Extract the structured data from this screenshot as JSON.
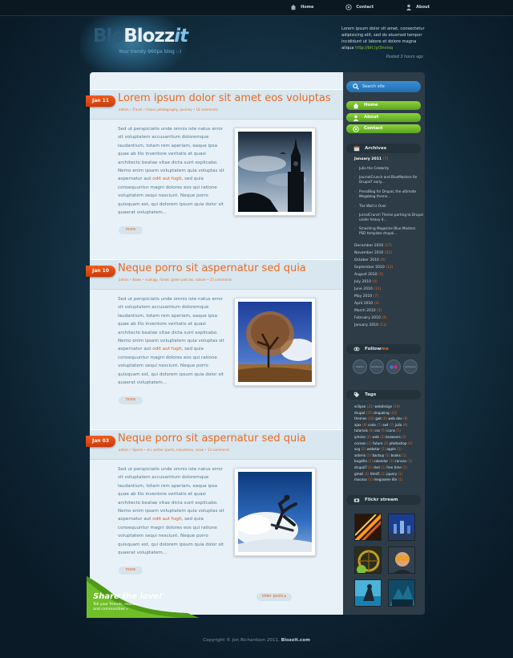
{
  "topnav": {
    "items": [
      {
        "label": "Home",
        "icon": "house-icon"
      },
      {
        "label": "Contact",
        "icon": "at-icon"
      },
      {
        "label": "About",
        "icon": "user-icon"
      }
    ]
  },
  "header": {
    "logo_ghost": "Blo",
    "logo_main": "Blozz",
    "logo_it": "it",
    "tagline": "Your trendy 960px blog :-)"
  },
  "tweet": {
    "text": "Lorem ipsum dolor sit amet, consectetur adipisicing elit, sed do eiusmod tempor incididunt ut labore et dolore magna aliqua",
    "link": "http://bit.ly/3nvisq",
    "time": "Posted 3 hours ago"
  },
  "posts": [
    {
      "date": "Jan 11",
      "title": "Lorem ipsum dolor sit amet eos voluptas",
      "meta": [
        "admin",
        "Travel",
        "travel, photography, journey",
        "18 comments"
      ],
      "text_a": "Sed ut perspiciatis unde omnis iste natus error sit voluptatem accusantium doloremque laudantium, totam rem aperiam, eaque ipsa quae ab illo inventore veritatis et quasi architecto beatae vitae dicta sunt explicabo. Nemo enim ipsam voluptatem quia voluptas sit aspernatur aut ",
      "highlight": "odit aut fugit",
      "text_b": ", sed quia consequuntur magni dolores eos qui ratione voluptatem sequi nesciunt. Neque porro quisquam est, qui dolorem ipsum quia dolor sit quaerat voluptatem...",
      "more": "more"
    },
    {
      "date": "Jan 10",
      "title": "Neque porro sit aspernatur sed quia",
      "meta": [
        "admin",
        "News",
        "ecology, forest, green policies, nature",
        "25 comments"
      ],
      "text_a": "Sed ut perspiciatis unde omnis iste natus error sit voluptatem accusantium doloremque laudantium, totam rem aperiam, eaque ipsa quae ab illo inventore veritatis et quasi architecto beatae vitae dicta sunt explicabo. Nemo enim ipsam voluptatem quia voluptas sit aspernatur aut ",
      "highlight": "odit aut fugit",
      "text_b": ", sed quia consequuntur magni dolores eos qui ratione voluptatem sequi nesciunt. Neque porro quisquam est, qui dolorem ipsum quia dolor sit quaerat voluptatem...",
      "more": "more"
    },
    {
      "date": "Jan 03",
      "title": "Neque porro sit aspernatur sed quia",
      "meta": [
        "admin",
        "Sports",
        "ski, winter sports, mountains, snow",
        "13 comments"
      ],
      "text_a": "Sed ut perspiciatis unde omnis iste natus error sit voluptatem accusantium doloremque laudantium, totam rem aperiam, eaque ipsa quae ab illo inventore veritatis et quasi architecto beatae vitae dicta sunt explicabo. Nemo enim ipsam voluptatem quia voluptas sit aspernatur aut ",
      "highlight": "odit aut fugit",
      "text_b": ", sed quia consequuntur magni dolores eos qui ratione voluptatem sequi nesciunt. Neque porro quisquam est, qui dolorem ipsum quia dolor sit quaerat voluptatem...",
      "more": "more"
    }
  ],
  "older": "older posts ▸",
  "share": {
    "title": "Share the love!",
    "sub": "Tell your friends, readers and communities »"
  },
  "sidebar": {
    "search_placeholder": "Search site",
    "nav": [
      "Home",
      "About",
      "Contact"
    ],
    "archives_title": "Archives",
    "current_year": "January 2011",
    "current_count": "(7)",
    "recent_posts": [
      "Julia the Celebrity",
      "JournalCrunch and BlueMasters for Drupal7 early...",
      "PressBlog for Drupal, the ultimate Megablog theme...",
      "The Wall is Over",
      "JurnalCrunch Theme porting to Drupal under heavy d...",
      "Smashing Magazine Blue Masters PSD template drupal..."
    ],
    "months": [
      {
        "label": "December 2010",
        "count": "(17)"
      },
      {
        "label": "November 2010",
        "count": "(22)"
      },
      {
        "label": "October 2010",
        "count": "(9)"
      },
      {
        "label": "September 2010",
        "count": "(12)"
      },
      {
        "label": "August 2010",
        "count": "(5)"
      },
      {
        "label": "July 2010",
        "count": "(4)"
      },
      {
        "label": "June 2010",
        "count": "(11)"
      },
      {
        "label": "May 2010",
        "count": "(7)"
      },
      {
        "label": "April 2010",
        "count": "(3)"
      },
      {
        "label": "March 2010",
        "count": "(5)"
      },
      {
        "label": "February 2010",
        "count": "(4)"
      },
      {
        "label": "January 2010",
        "count": "(11)"
      }
    ],
    "follow_a": "Follow",
    "follow_b": "me",
    "follow_icons": [
      "twitter",
      "facebook",
      "flickr",
      "delicious"
    ],
    "tags_title": "Tags",
    "tag_lines": [
      [
        {
          "t": "eclipse",
          "c": "(21)"
        },
        {
          "t": "webdesign",
          "c": "(19)"
        }
      ],
      [
        {
          "t": "drupal",
          "c": "(15)"
        },
        {
          "t": "drupaling",
          "c": "(10)"
        }
      ],
      [
        {
          "t": "themes",
          "c": "(10)"
        },
        {
          "t": "gwt",
          "c": "(9)"
        },
        {
          "t": "web dev",
          "c": "(9)"
        }
      ],
      [
        {
          "t": "ajax",
          "c": "(8)"
        },
        {
          "t": "code",
          "c": "(7)"
        },
        {
          "t": "swt",
          "c": "(7)"
        },
        {
          "t": "julia",
          "c": "(6)"
        }
      ],
      [
        {
          "t": "tutorials",
          "c": "(6)"
        },
        {
          "t": "css",
          "c": "(5)"
        },
        {
          "t": "icons",
          "c": "(5)"
        }
      ],
      [
        {
          "t": "iphone",
          "c": "(4)"
        },
        {
          "t": "web",
          "c": "(3)"
        },
        {
          "t": "browsers",
          "c": "(2)"
        }
      ],
      [
        {
          "t": "cocoon",
          "c": "(2)"
        },
        {
          "t": "future",
          "c": "(2)"
        },
        {
          "t": "photoshop",
          "c": "(2)"
        }
      ],
      [
        {
          "t": "svg",
          "c": "(2)"
        },
        {
          "t": "webstar",
          "c": "(2)"
        },
        {
          "t": "apple",
          "c": "(1)"
        }
      ],
      [
        {
          "t": "asterix",
          "c": "(1)"
        },
        {
          "t": "backup",
          "c": "(1)"
        },
        {
          "t": "books",
          "c": "(1)"
        }
      ],
      [
        {
          "t": "bugzilla",
          "c": "(1)"
        },
        {
          "t": "calendar",
          "c": "(1)"
        },
        {
          "t": "canvas",
          "c": "(1)"
        }
      ],
      [
        {
          "t": "drupal7",
          "c": "(1)"
        },
        {
          "t": "dvd",
          "c": "(1)"
        },
        {
          "t": "free time",
          "c": "(1)"
        }
      ],
      [
        {
          "t": "gmail",
          "c": "(1)"
        },
        {
          "t": "html5",
          "c": "(1)"
        },
        {
          "t": "jquery",
          "c": "(1)"
        }
      ],
      [
        {
          "t": "macosx",
          "c": "(1)"
        },
        {
          "t": "megaseen lite",
          "c": "(1)"
        }
      ]
    ],
    "flickr_title": "Flickr stream"
  },
  "footer": {
    "text": "Copyright © Jon Richardson 2011, ",
    "site": "Blozzit.com"
  }
}
